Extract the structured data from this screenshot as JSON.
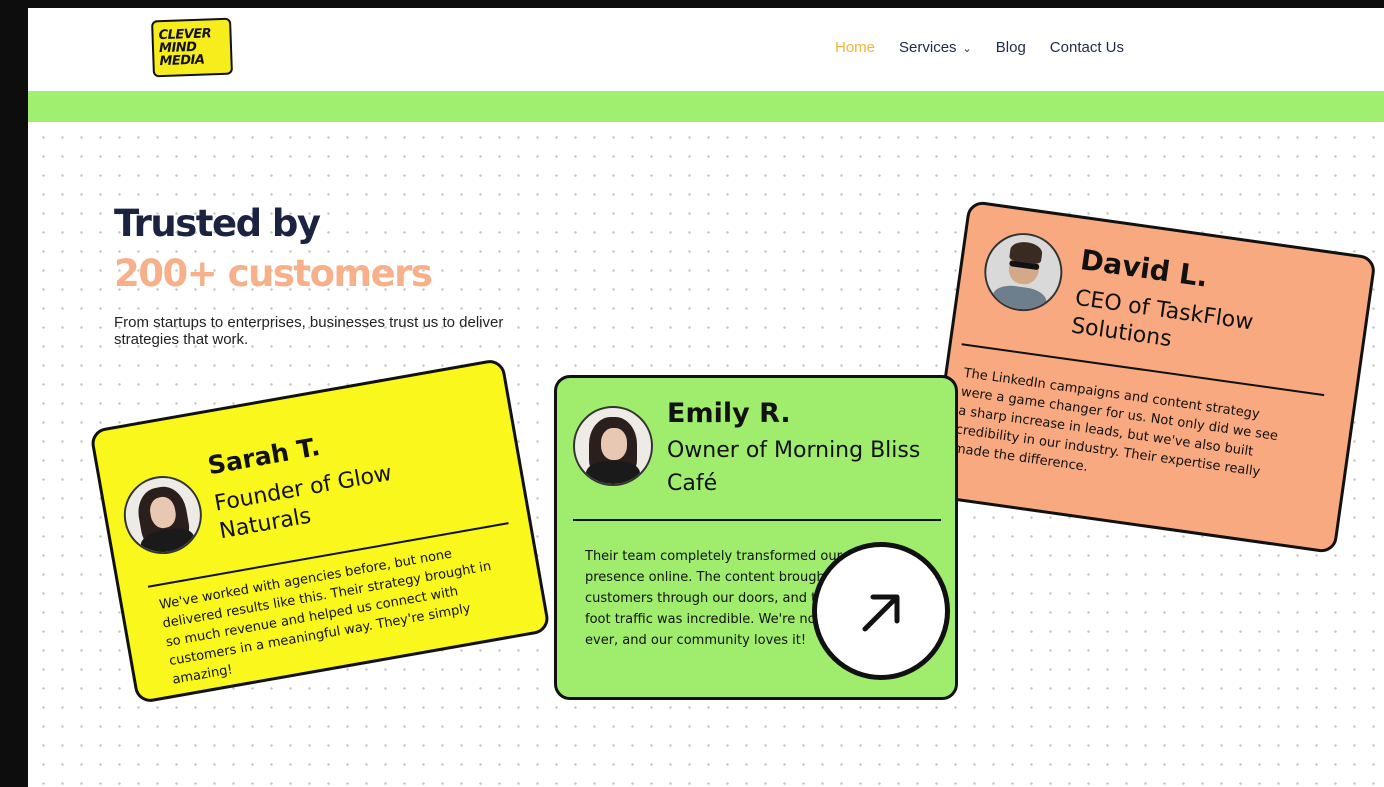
{
  "logo": {
    "line1": "CLEVER",
    "line2": "MIND",
    "line3": "MEDIA"
  },
  "nav": {
    "home": "Home",
    "services": "Services",
    "blog": "Blog",
    "contact": "Contact Us"
  },
  "hero": {
    "title_line1": "Trusted by",
    "title_line2": "200+ customers",
    "subtitle": "From startups to enterprises, businesses trust us to deliver strategies that work."
  },
  "testimonials": [
    {
      "name": "Sarah T.",
      "role": "Founder of Glow Naturals",
      "quote": "We've worked with agencies before, but none delivered results like this. Their strategy brought in so much revenue and helped us connect with customers in a meaningful way. They're simply amazing!",
      "color": "#f9f71b"
    },
    {
      "name": "Emily R.",
      "role": "Owner of Morning Bliss Café",
      "quote": "Their team completely transformed our café's presence online. The content brought so many customers through our doors, and the increase in foot traffic was incredible. We're now busier than ever, and our community loves it!",
      "color": "#a0ec6c"
    },
    {
      "name": "David L.",
      "role": "CEO of TaskFlow Solutions",
      "quote": "The LinkedIn campaigns and content strategy were a game changer for us. Not only did we see a sharp increase in leads, but we've also built credibility in our industry. Their expertise really made the difference.",
      "color": "#f8a97f"
    }
  ],
  "icons": {
    "arrow": "arrow-up-right-icon",
    "chevron": "chevron-down-icon"
  },
  "colors": {
    "accent_green": "#a0ef6e",
    "nav_active": "#f5b43a",
    "heading_orange": "#f7b08a"
  }
}
